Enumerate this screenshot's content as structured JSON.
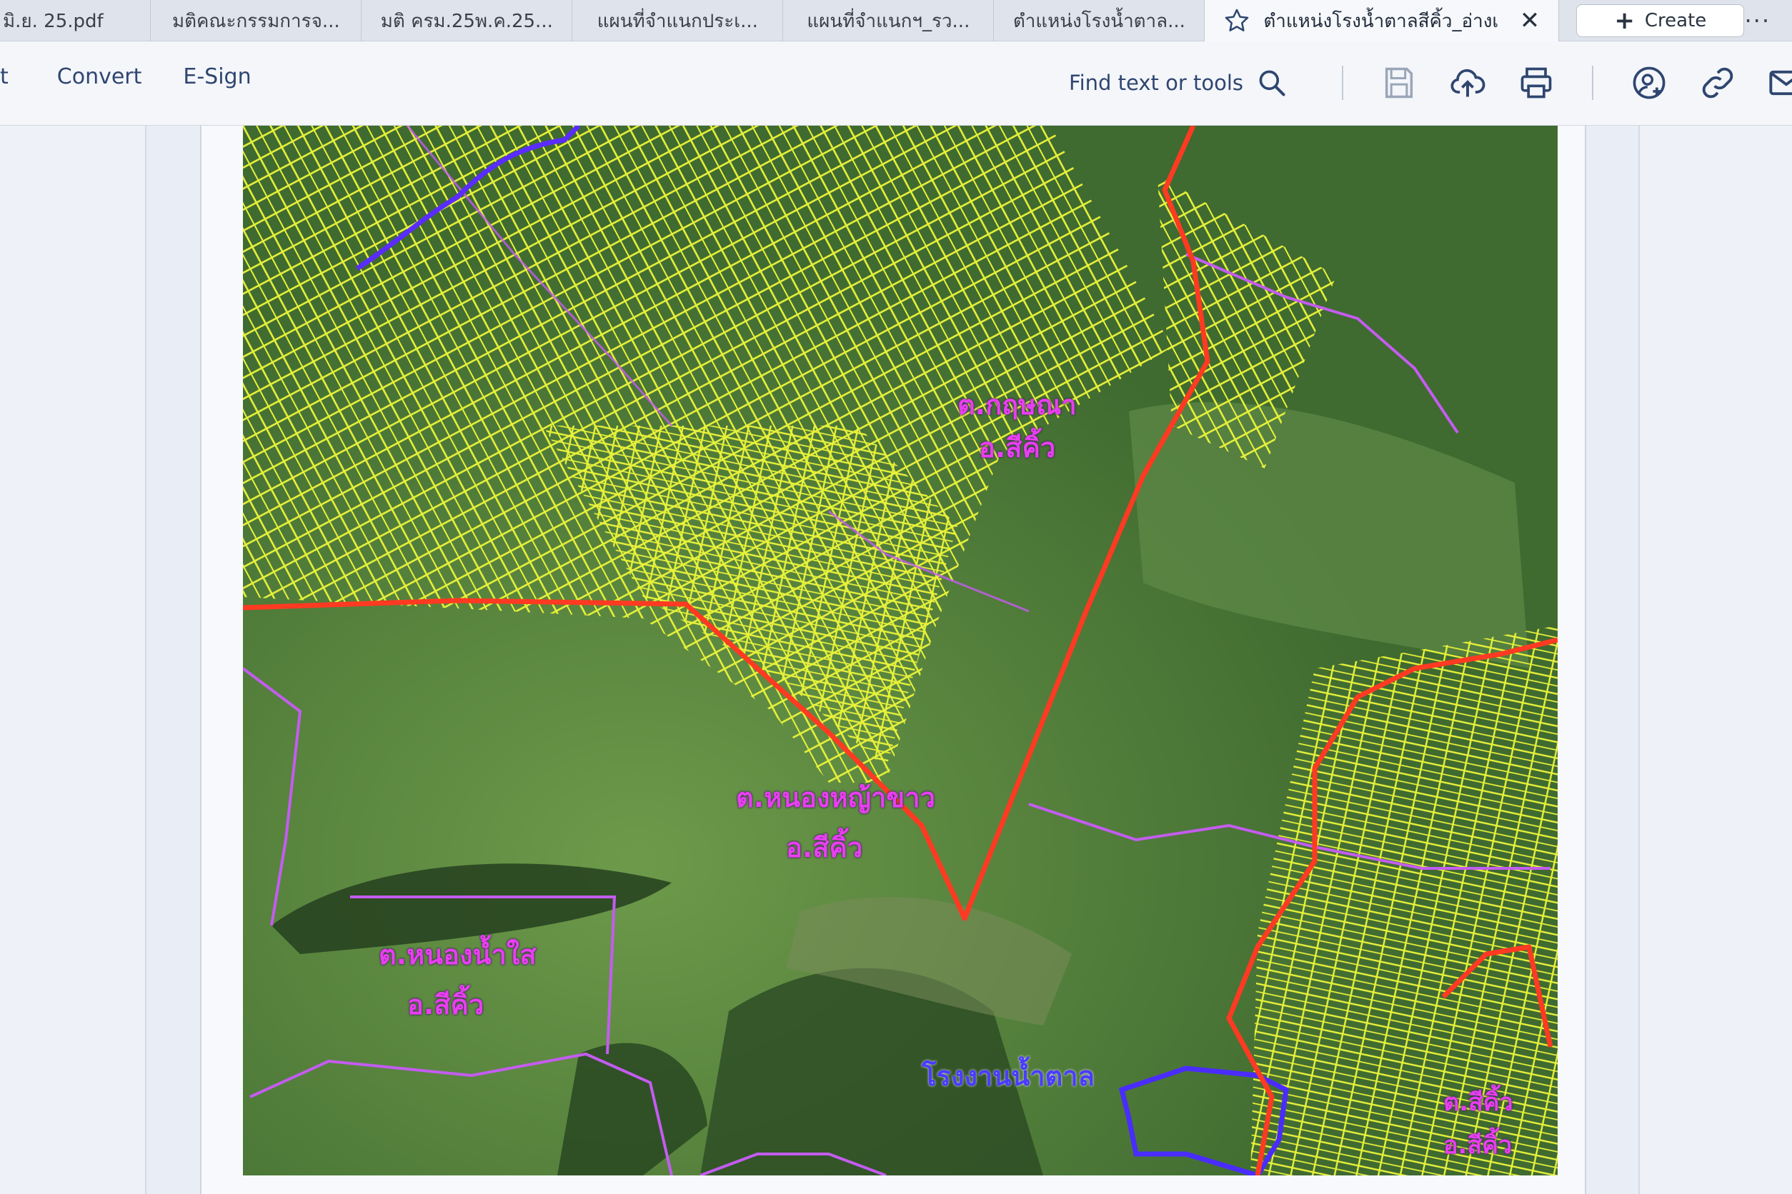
{
  "tabs": [
    {
      "label": "มิ.ย. 25.pdf"
    },
    {
      "label": "มติคณะกรรมการจ..."
    },
    {
      "label": "มติ ครม.25พ.ค.25..."
    },
    {
      "label": "แผนที่จำแนกประเ..."
    },
    {
      "label": "แผนที่จำแนกฯ_รว..."
    },
    {
      "label": "ตำแหน่งโรงน้ำตาล..."
    },
    {
      "label": "ตำแหน่งโรงน้ำตาลสีคิ้ว_อ่างเก็...",
      "active": true
    }
  ],
  "new_tab": {
    "label": "Create"
  },
  "toolbar": {
    "fragment": "t",
    "convert": "Convert",
    "esign": "E-Sign",
    "find_placeholder": "Find text or tools"
  },
  "icons": [
    "star-icon",
    "close-icon",
    "plus-icon",
    "more-icon",
    "search-icon",
    "save-icon",
    "upload-cloud-icon",
    "print-icon",
    "share-user-icon",
    "link-icon",
    "mail-icon"
  ],
  "colors": {
    "parcel": "#e8f23a",
    "district_boundary": "#ff3a22",
    "subdistrict_boundary": "#c45cf0",
    "factory_boundary": "#4a2cff",
    "label": "#e83ef0",
    "label_factory": "#4a3cff"
  },
  "map": {
    "labels": [
      {
        "id": "kut-yom-tambon",
        "text": "ต.กฤษณา"
      },
      {
        "id": "kut-yom-amphoe",
        "text": "อ.สีคิ้ว"
      },
      {
        "id": "nong-ya-khao-tambon",
        "text": "ต.หนองหญ้าขาว"
      },
      {
        "id": "nong-ya-khao-amphoe",
        "text": "อ.สีคิ้ว"
      },
      {
        "id": "nong-nam-sai-tambon",
        "text": "ต.หนองน้ำใส"
      },
      {
        "id": "nong-nam-sai-amphoe",
        "text": "อ.สีคิ้ว"
      },
      {
        "id": "sugar-factory",
        "text": "โรงงานน้ำตาล"
      },
      {
        "id": "sikhio-tambon",
        "text": "ต.สีคิ้ว"
      },
      {
        "id": "sikhio-amphoe",
        "text": "อ.สีคิ้ว"
      }
    ]
  }
}
